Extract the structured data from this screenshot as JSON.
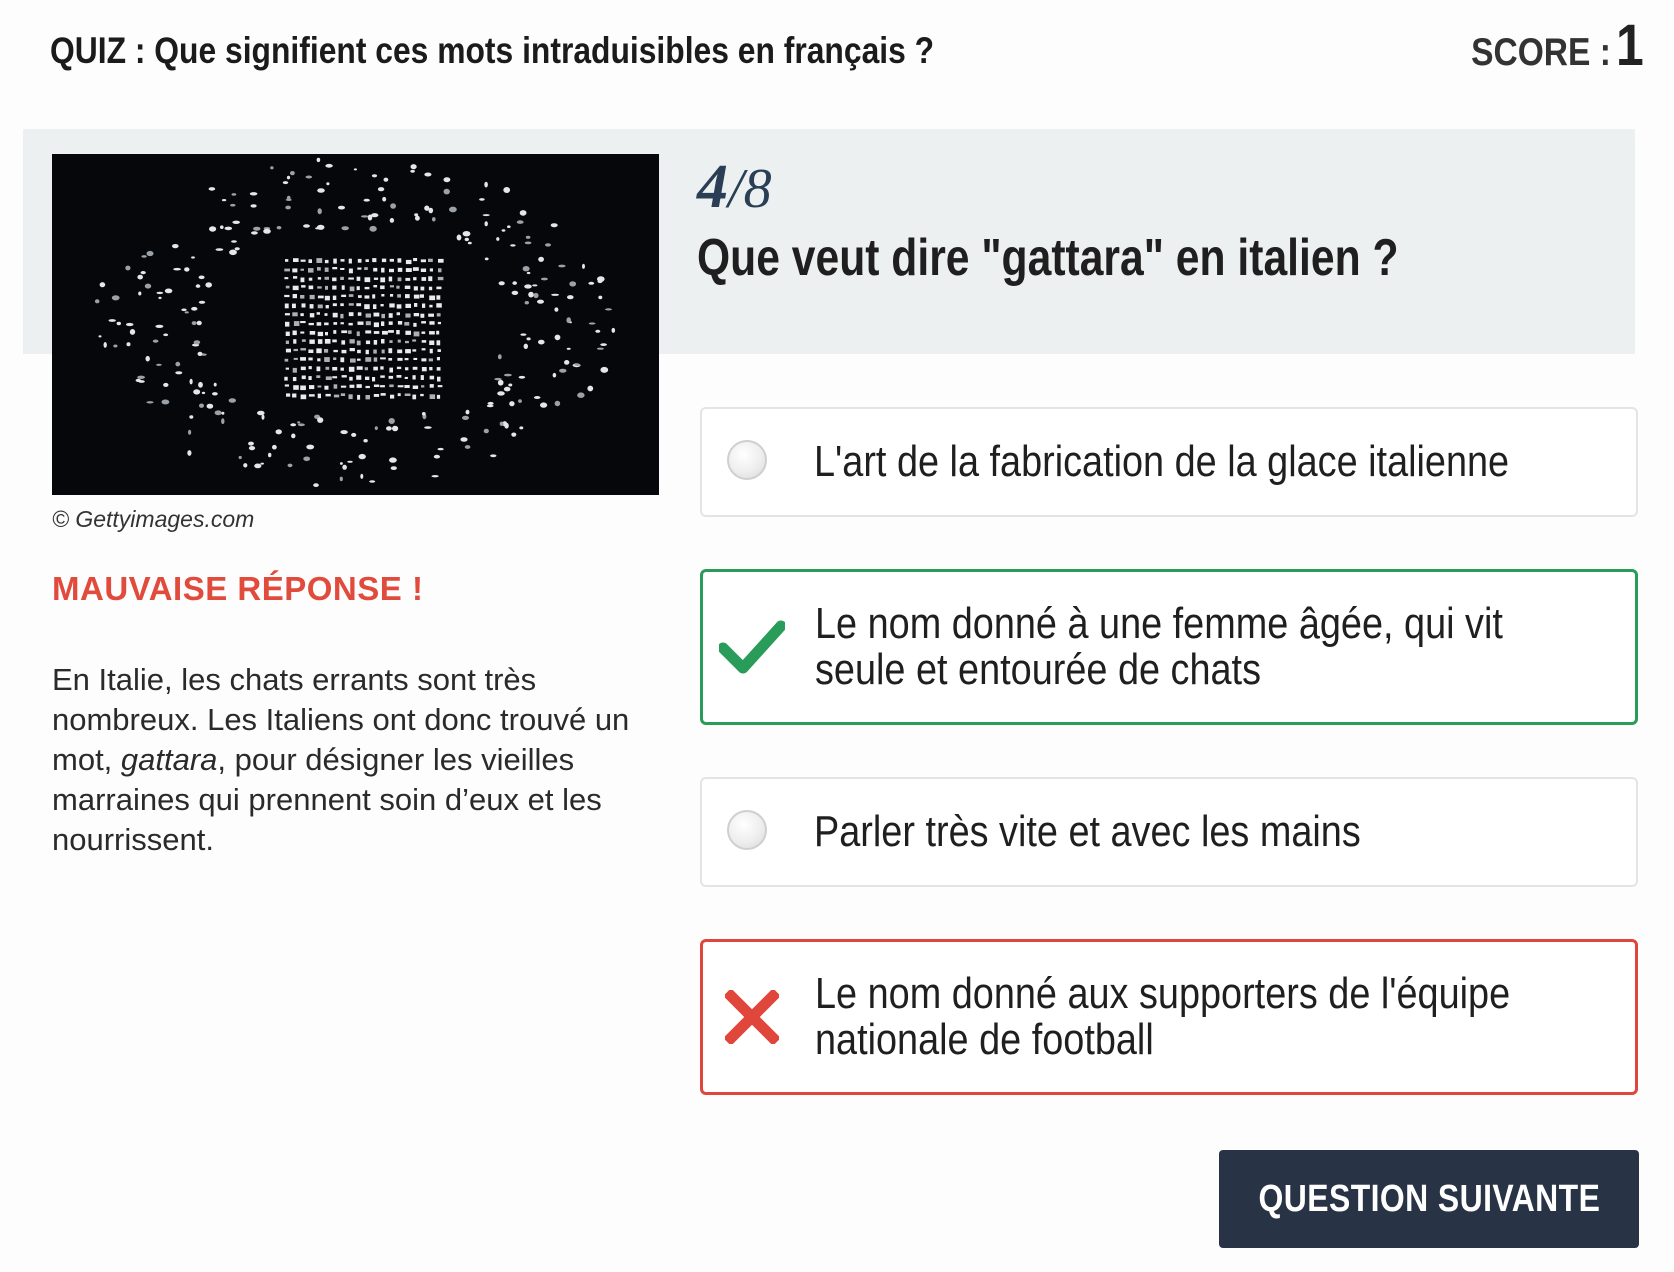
{
  "header": {
    "title": "QUIZ : Que signifient ces mots intraduisibles en français ?",
    "score_label": "SCORE :",
    "score_value": "1"
  },
  "question": {
    "progress_current": "4",
    "progress_separator": "/",
    "progress_total": "8",
    "text": "Que veut dire \"gattara\" en italien ?"
  },
  "image": {
    "credit": "© Gettyimages.com"
  },
  "feedback": {
    "verdict": "MAUVAISE RÉPONSE !",
    "explanation_before": "En Italie, les chats errants sont très nombreux. Les Italiens ont donc trouvé un mot, ",
    "explanation_term": "gattara",
    "explanation_after": ", pour désigner les vieilles marraines qui prennent soin d’eux et les nourrissent."
  },
  "answers": [
    {
      "lines": [
        "L'art de la fabrication de la glace italienne"
      ],
      "state": "unselected"
    },
    {
      "lines": [
        "Le nom donné à une femme âgée, qui vit",
        "seule et entourée de chats"
      ],
      "state": "correct"
    },
    {
      "lines": [
        "Parler très vite et avec les mains"
      ],
      "state": "unselected"
    },
    {
      "lines": [
        "Le nom donné aux supporters de l'équipe",
        "nationale de football"
      ],
      "state": "wrong"
    }
  ],
  "next_button": {
    "label": "QUESTION SUIVANTE"
  },
  "colors": {
    "correct": "#2a9c59",
    "wrong": "#e0463a",
    "verdict": "#e14b3b",
    "button_bg": "#283445",
    "band_bg": "#edf0f0"
  },
  "icons": {
    "correct": "check-icon",
    "wrong": "cross-icon",
    "unselected": "radio-icon"
  }
}
